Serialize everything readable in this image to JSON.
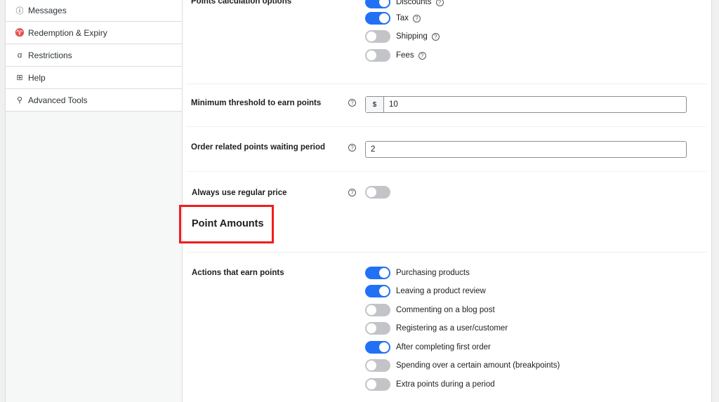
{
  "sidebar": {
    "items": [
      {
        "label": "Messages",
        "icon": "info-icon"
      },
      {
        "label": "Redemption & Expiry",
        "icon": "trophy-icon"
      },
      {
        "label": "Restrictions",
        "icon": "user-icon"
      },
      {
        "label": "Help",
        "icon": "help-box-icon"
      },
      {
        "label": "Advanced Tools",
        "icon": "wrench-icon"
      }
    ]
  },
  "points_calc": {
    "label": "Points calculation options",
    "options": [
      {
        "label": "Discounts",
        "on": true
      },
      {
        "label": "Tax",
        "on": true
      },
      {
        "label": "Shipping",
        "on": false
      },
      {
        "label": "Fees",
        "on": false
      }
    ]
  },
  "min_threshold": {
    "label": "Minimum threshold to earn points",
    "prefix": "$",
    "value": "10"
  },
  "waiting_period": {
    "label": "Order related points waiting period",
    "value": "2"
  },
  "regular_price": {
    "label": "Always use regular price",
    "on": false
  },
  "point_amounts": {
    "title": "Point Amounts"
  },
  "actions": {
    "label": "Actions that earn points",
    "options": [
      {
        "label": "Purchasing products",
        "on": true
      },
      {
        "label": "Leaving a product review",
        "on": true
      },
      {
        "label": "Commenting on a blog post",
        "on": false
      },
      {
        "label": "Registering as a user/customer",
        "on": false
      },
      {
        "label": "After completing first order",
        "on": true
      },
      {
        "label": "Spending over a certain amount (breakpoints)",
        "on": false
      },
      {
        "label": "Extra points during a period",
        "on": false
      }
    ]
  },
  "help_glyph": "?",
  "colors": {
    "accent": "#2271f5",
    "highlight": "#f21c1c",
    "toggle_off": "#c3c4c7"
  }
}
